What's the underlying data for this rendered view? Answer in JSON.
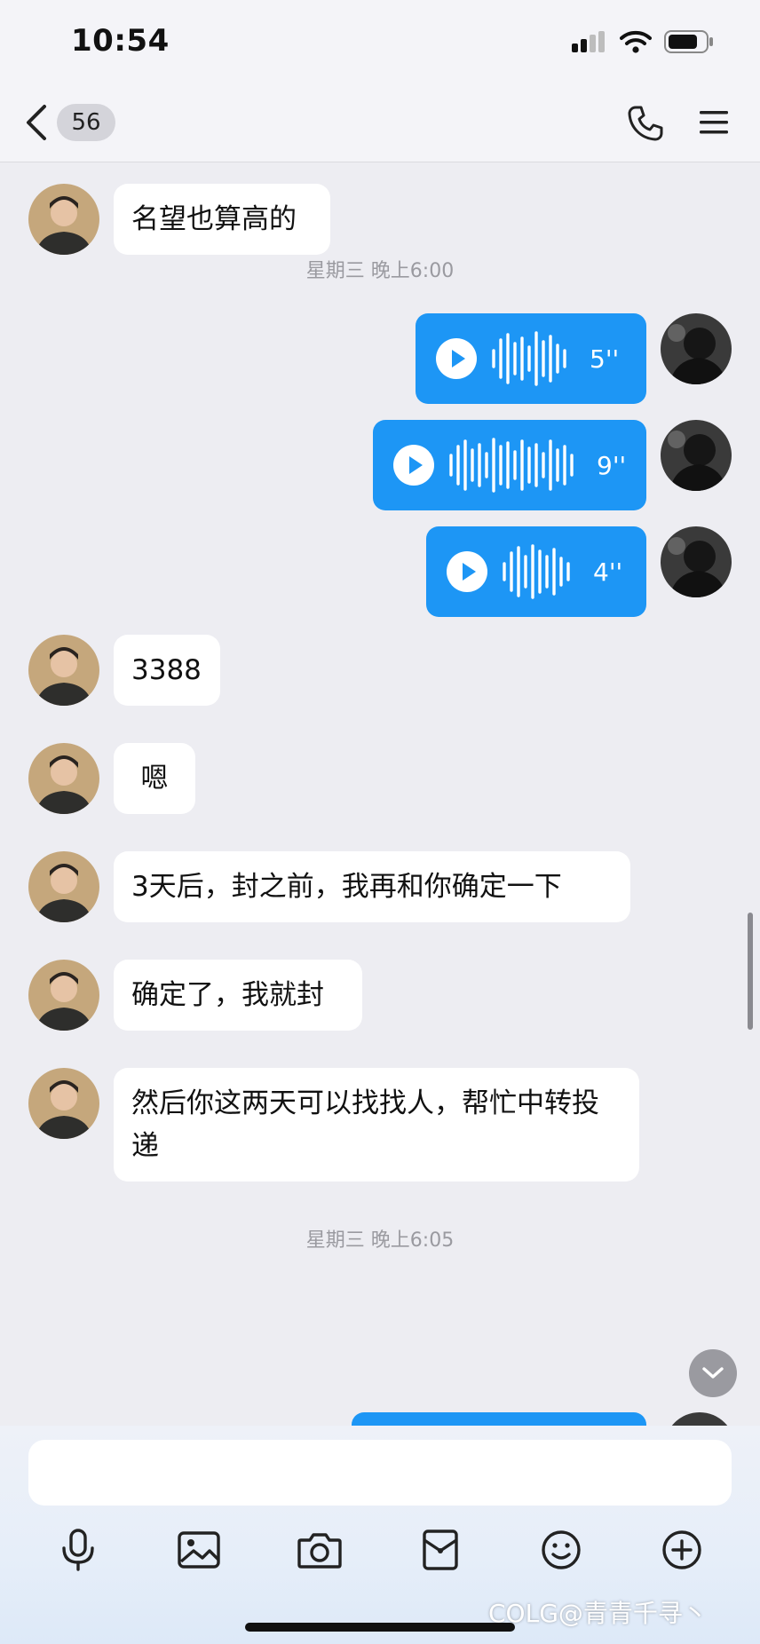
{
  "status_bar": {
    "time": "10:54"
  },
  "nav": {
    "unread_count": "56"
  },
  "messages": [
    {
      "text": "名望也算高的"
    },
    {
      "timestamp": "星期三 晚上6:00"
    },
    {
      "voice_duration": "5''"
    },
    {
      "voice_duration": "9''"
    },
    {
      "voice_duration": "4''"
    },
    {
      "text": "3388"
    },
    {
      "text": "嗯"
    },
    {
      "text": "3天后，封之前，我再和你确定一下"
    },
    {
      "text": "确定了，我就封"
    },
    {
      "text": "然后你这两天可以找找人，帮忙中转投递"
    },
    {
      "timestamp": "星期三 晚上6:05"
    }
  ],
  "watermark": "COLG@青青千寻丶",
  "colors": {
    "accent": "#1d96f5",
    "background": "#ededf2"
  }
}
